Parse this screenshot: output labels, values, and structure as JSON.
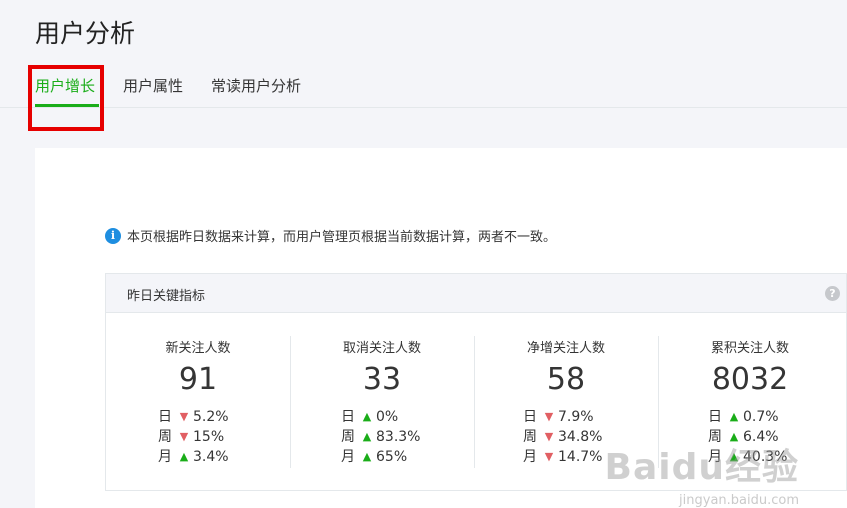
{
  "page_title": "用户分析",
  "tabs": [
    {
      "label": "用户增长",
      "active": true
    },
    {
      "label": "用户属性",
      "active": false
    },
    {
      "label": "常读用户分析",
      "active": false
    }
  ],
  "notice": {
    "icon": "info-icon",
    "text": "本页根据昨日数据来计算，而用户管理页根据当前数据计算，两者不一致。"
  },
  "metrics": {
    "title": "昨日关键指标",
    "help_icon": "?",
    "items": [
      {
        "label": "新关注人数",
        "value": "91",
        "trends": [
          {
            "period": "日",
            "direction": "down",
            "pct": "5.2%"
          },
          {
            "period": "周",
            "direction": "down",
            "pct": "15%"
          },
          {
            "period": "月",
            "direction": "up",
            "pct": "3.4%"
          }
        ]
      },
      {
        "label": "取消关注人数",
        "value": "33",
        "trends": [
          {
            "period": "日",
            "direction": "up",
            "pct": "0%"
          },
          {
            "period": "周",
            "direction": "up",
            "pct": "83.3%"
          },
          {
            "period": "月",
            "direction": "up",
            "pct": "65%"
          }
        ]
      },
      {
        "label": "净增关注人数",
        "value": "58",
        "trends": [
          {
            "period": "日",
            "direction": "down",
            "pct": "7.9%"
          },
          {
            "period": "周",
            "direction": "down",
            "pct": "34.8%"
          },
          {
            "period": "月",
            "direction": "down",
            "pct": "14.7%"
          }
        ]
      },
      {
        "label": "累积关注人数",
        "value": "8032",
        "trends": [
          {
            "period": "日",
            "direction": "up",
            "pct": "0.7%"
          },
          {
            "period": "周",
            "direction": "up",
            "pct": "6.4%"
          },
          {
            "period": "月",
            "direction": "up",
            "pct": "40.3%"
          }
        ]
      }
    ]
  },
  "colors": {
    "accent": "#1aad19",
    "down": "#e15f63",
    "up": "#1aad19",
    "highlight": "#e60000"
  },
  "watermark": {
    "text": "Baidu经验",
    "sub": "jingyan.baidu.com"
  }
}
